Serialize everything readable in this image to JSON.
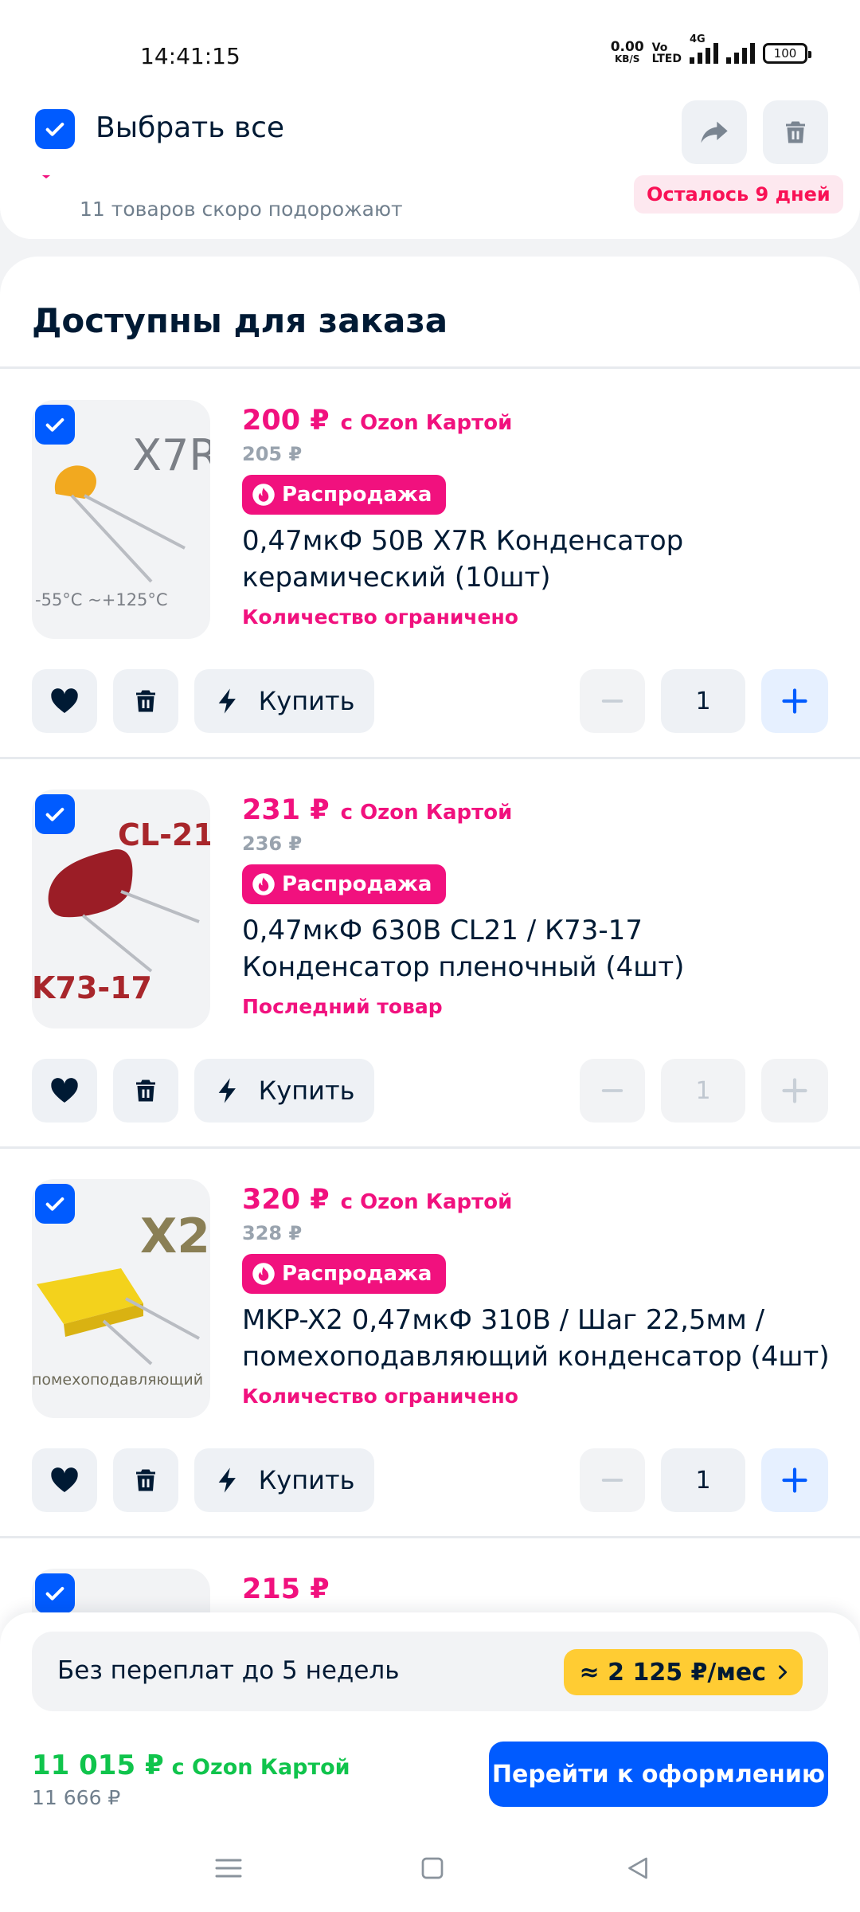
{
  "status_bar": {
    "time": "14:41:15",
    "net_speed": "0.00",
    "net_unit": "KB/S",
    "volte_top": "Vo",
    "volte_bottom": "LTED",
    "network": "4G",
    "battery": "100"
  },
  "header": {
    "select_all_label": "Выбрать все",
    "share_icon": "share-icon",
    "trash_icon": "trash-icon"
  },
  "notice": {
    "text": "11 товаров скоро подорожают",
    "badge": "Осталось 9 дней"
  },
  "section": {
    "title": "Доступны для заказа"
  },
  "products": [
    {
      "thumb_label": "X7R",
      "thumb_caption": "-55°C ~+125°C",
      "price": "200 ₽",
      "price_note": "с Ozon Картой",
      "old_price": "205 ₽",
      "badge": "Распродажа",
      "title": "0,47мкФ 50В X7R Конденсатор керамический (10шт)",
      "stock": "Количество ограничено",
      "buy_label": "Купить",
      "quantity": "1",
      "qty_enabled": true
    },
    {
      "thumb_label": "CL-21",
      "thumb_caption": "K73-17",
      "price": "231 ₽",
      "price_note": "с Ozon Картой",
      "old_price": "236 ₽",
      "badge": "Распродажа",
      "title": "0,47мкФ 630В CL21 / К73-17 Конденсатор пленочный (4шт)",
      "stock": "Последний товар",
      "buy_label": "Купить",
      "quantity": "1",
      "qty_enabled": false
    },
    {
      "thumb_label": "X2",
      "thumb_caption": "помехоподавляющий",
      "price": "320 ₽",
      "price_note": "с Ozon Картой",
      "old_price": "328 ₽",
      "badge": "Распродажа",
      "title": "MKP-X2 0,47мкФ 310В / Шаг 22,5мм / помехоподавляющий конденсатор (4шт)",
      "stock": "Количество ограничено",
      "buy_label": "Купить",
      "quantity": "1",
      "qty_enabled": true
    },
    {
      "price": "215 ₽"
    }
  ],
  "bottom": {
    "installment_text": "Без переплат до 5 недель",
    "installment_chip": "≈ 2 125 ₽/мес",
    "total_price": "11 015 ₽",
    "total_note": "с Ozon Картой",
    "total_old": "11 666 ₽",
    "checkout_label": "Перейти к оформлению"
  },
  "colors": {
    "brand_blue": "#005bff",
    "sale_pink": "#f1117e",
    "green": "#10c44c",
    "yellow": "#ffcc33"
  }
}
